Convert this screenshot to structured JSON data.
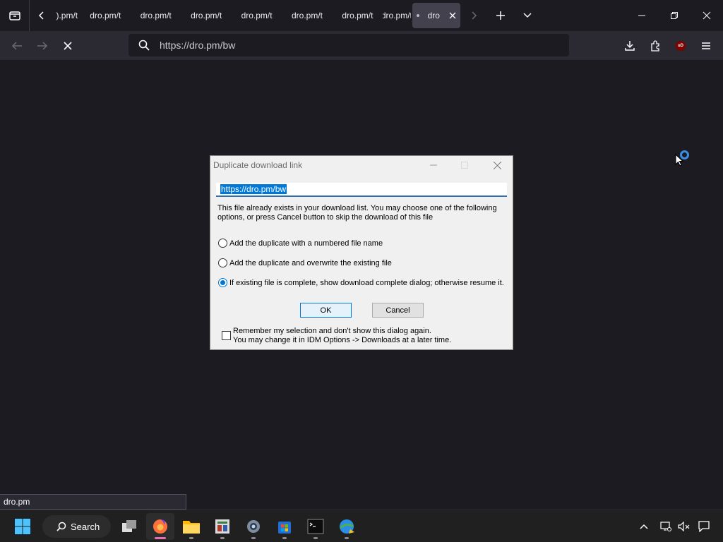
{
  "tabs": {
    "first_partial_label": ").pm/t",
    "labels": [
      "dro.pm/t",
      "dro.pm/t",
      "dro.pm/t",
      "dro.pm/t",
      "dro.pm/t",
      "dro.pm/t",
      "dro.pm/t"
    ],
    "active_label": "dro"
  },
  "navbar": {
    "url": "https://dro.pm/bw",
    "ublock_badge": "uD"
  },
  "status_bar": {
    "text": "dro.pm"
  },
  "dialog": {
    "title": "Duplicate download link",
    "url_value": "https://dro.pm/bw",
    "message": "This file already exists in your download list. You may choose one of the following options, or press Cancel button to skip the download of this file",
    "options": [
      {
        "label": "Add the duplicate with a numbered file name",
        "selected": false
      },
      {
        "label": "Add the duplicate and overwrite the existing file",
        "selected": false
      },
      {
        "label": "If existing file is complete, show download complete dialog; otherwise resume it.",
        "selected": true
      }
    ],
    "ok_label": "OK",
    "cancel_label": "Cancel",
    "remember_line1": "Remember my selection and don't show this dialog again.",
    "remember_line2": "You may change it in IDM Options -> Downloads at a later time.",
    "remember_checked": false
  },
  "taskbar": {
    "search_label": "Search"
  },
  "colors": {
    "browser_bg": "#1c1b22",
    "toolbar_bg": "#2b2a33",
    "accent_blue": "#0078d7",
    "taskbar_bg": "#202020"
  }
}
